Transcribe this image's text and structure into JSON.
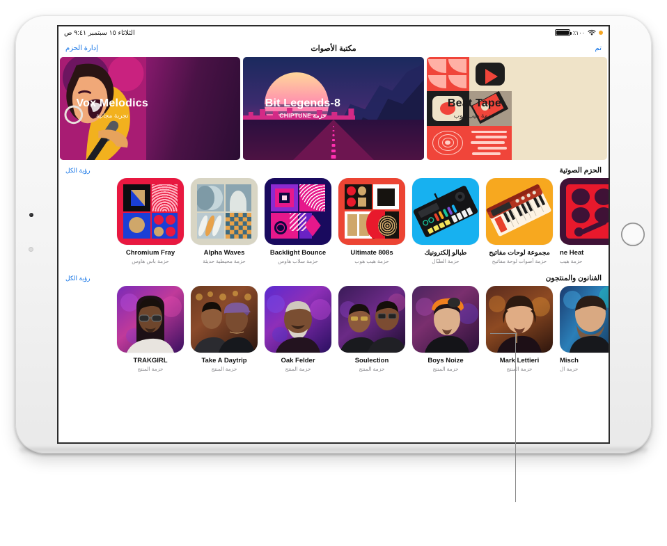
{
  "status_bar": {
    "battery_percent": "٪١٠٠",
    "wifi_icon": "wifi-icon",
    "recording_indicator": "orange-dot-icon",
    "datetime": "الثلاثاء ١٥ سبتمبر ٩:٤١ ص"
  },
  "nav": {
    "done_label": "تم",
    "title": "مكتبة الأصوات",
    "manage_label": "إدارة الحزم"
  },
  "featured": [
    {
      "title": "Beat Tape",
      "subtitle": "حزمة هيب هوب",
      "name": "featured-card-beat-tape"
    },
    {
      "title": "8-Bit Legends",
      "subtitle": "حزمة CHIPTUNE",
      "name": "featured-card-8-bit-legends"
    },
    {
      "title": "Vox Melodics",
      "subtitle": "تجربة مجانية",
      "name": "featured-card-vox-melodics"
    }
  ],
  "sections": [
    {
      "title": "الحزم الصوتية",
      "see_all": "رؤية الكل"
    },
    {
      "title": "الفنانون والمنتجون",
      "see_all": "رؤية الكل"
    }
  ],
  "sound_packs": [
    {
      "name": "ne Heat",
      "sub": "حزمة هيب",
      "clipped": true
    },
    {
      "name": "مجموعة لوحات مفاتيح",
      "sub": "حزمة أصوات لوحة مفاتيح"
    },
    {
      "name": "طبالو إلكترونيك",
      "sub": "حزمة الطبّال"
    },
    {
      "name": "Ultimate 808s",
      "sub": "حزمة هيب هوب"
    },
    {
      "name": "Backlight Bounce",
      "sub": "حزمة سلاب هاوس"
    },
    {
      "name": "Alpha Waves",
      "sub": "حزمة محيطية حديثة"
    },
    {
      "name": "Chromium Fray",
      "sub": "حزمة باس هاوس"
    }
  ],
  "artists": [
    {
      "name": "Misch",
      "sub": "حزمة ال",
      "clipped": true
    },
    {
      "name": "Mark Lettieri",
      "sub": "حزمة المنتج"
    },
    {
      "name": "Boys Noize",
      "sub": "حزمة المنتج"
    },
    {
      "name": "Soulection",
      "sub": "حزمة المنتج"
    },
    {
      "name": "Oak Felder",
      "sub": "حزمة المنتج"
    },
    {
      "name": "Take A Daytrip",
      "sub": "حزمة المنتج"
    },
    {
      "name": "TRAKGIRL",
      "sub": "حزمة المنتج"
    }
  ],
  "colors": {
    "accent": "#1273e6",
    "beat_tape_bg": "#efe3c8",
    "secondary_text": "#8b8b8f"
  }
}
